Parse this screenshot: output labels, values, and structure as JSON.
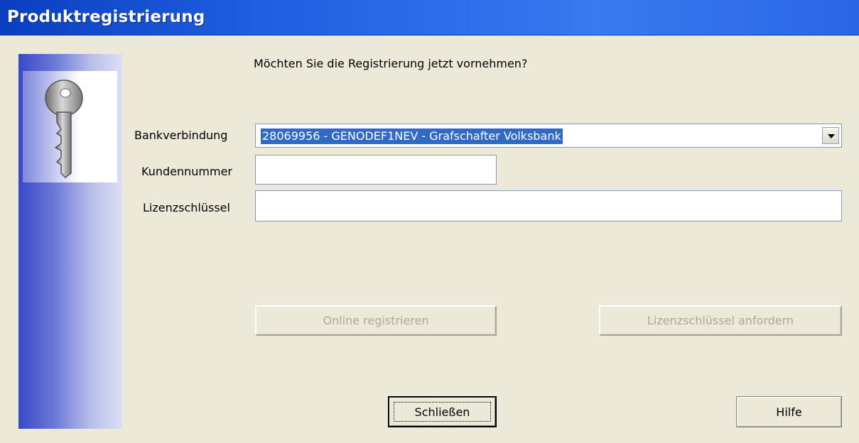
{
  "window": {
    "title": "Produktregistrierung"
  },
  "prompt": "Möchten Sie die Registrierung jetzt vornehmen?",
  "form": {
    "bank_label": "Bankverbindung",
    "bank_value": "28069956 - GENODEF1NEV - Grafschafter Volksbank",
    "customer_label": "Kundennummer",
    "customer_value": "",
    "license_label": "Lizenzschlüssel",
    "license_value": ""
  },
  "buttons": {
    "register_online": "Online registrieren",
    "request_license": "Lizenzschlüssel anfordern",
    "close": "Schließen",
    "help": "Hilfe"
  },
  "icons": {
    "banner": "key-icon",
    "dropdown": "chevron-down-icon"
  },
  "colors": {
    "titlebar": "#1f5ee0",
    "selection": "#316ac5",
    "dialog_bg": "#ece9d8"
  }
}
